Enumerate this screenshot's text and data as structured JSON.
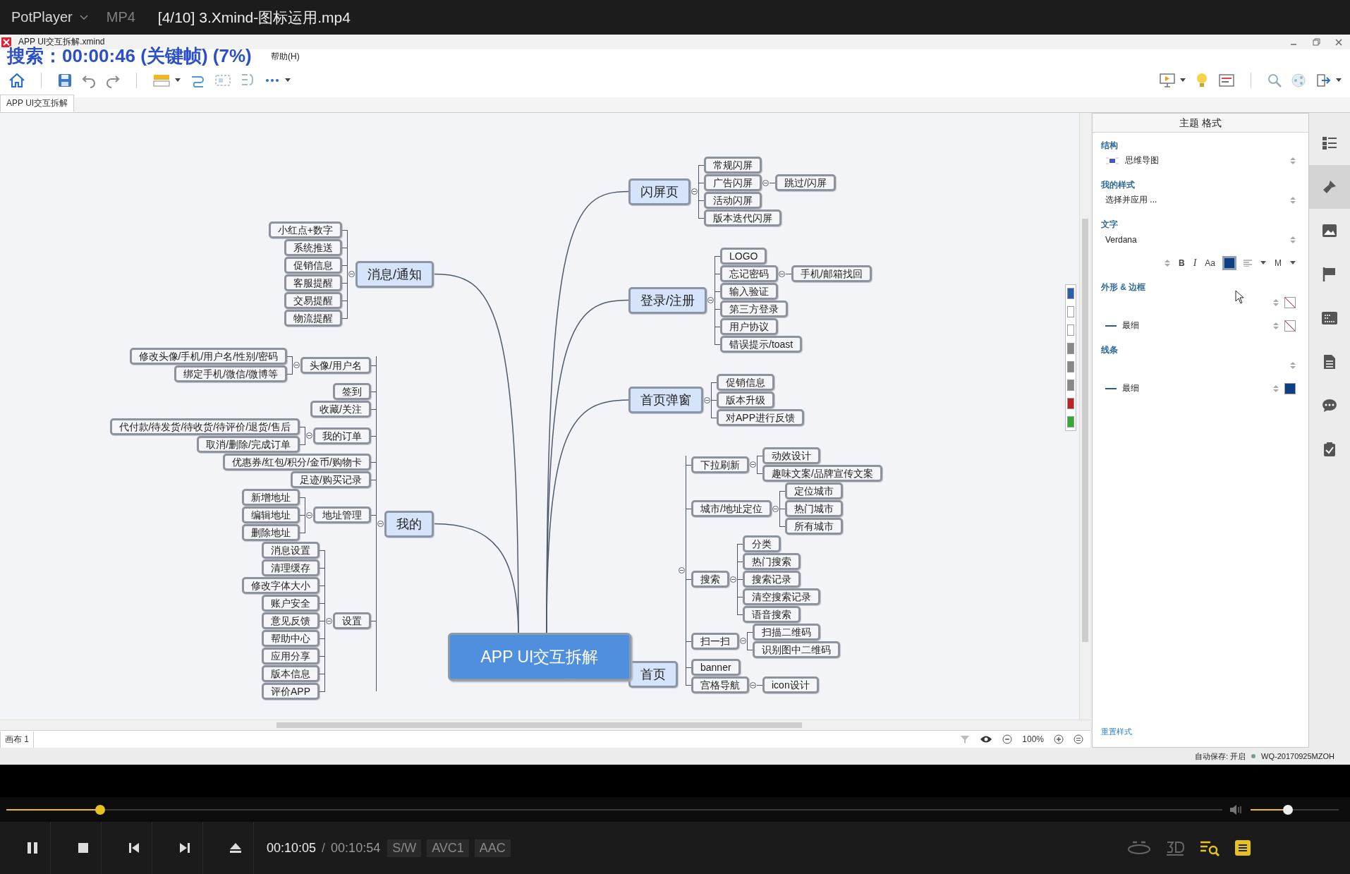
{
  "player": {
    "app_name": "PotPlayer",
    "format": "MP4",
    "title": "[4/10] 3.Xmind-图标运用.mp4"
  },
  "osd": "搜索：00:00:46 (关键帧) (7%)",
  "xmind": {
    "window_title": "APP UI交互拆解.xmind",
    "menu": [
      "帮助(H)"
    ],
    "tabs": [
      {
        "label": "APP UI交互拆解",
        "selected": true
      }
    ],
    "map": {
      "root": "APP UI交互拆解",
      "right": [
        {
          "text": "闪屏页",
          "children": [
            {
              "text": "常规闪屏"
            },
            {
              "text": "广告闪屏",
              "children": [
                {
                  "text": "跳过/闪屏"
                }
              ]
            },
            {
              "text": "活动闪屏"
            },
            {
              "text": "版本迭代闪屏"
            }
          ]
        },
        {
          "text": "登录/注册",
          "children": [
            {
              "text": "LOGO"
            },
            {
              "text": "忘记密码",
              "children": [
                {
                  "text": "手机/邮箱找回"
                }
              ]
            },
            {
              "text": "输入验证"
            },
            {
              "text": "第三方登录"
            },
            {
              "text": "用户协议"
            },
            {
              "text": "错误提示/toast"
            }
          ]
        },
        {
          "text": "首页弹窗",
          "children": [
            {
              "text": "促销信息"
            },
            {
              "text": "版本升级"
            },
            {
              "text": "对APP进行反馈"
            }
          ]
        },
        {
          "text": "首页",
          "children": [
            {
              "text": "下拉刷新",
              "children": [
                {
                  "text": "动效设计"
                },
                {
                  "text": "趣味文案/品牌宣传文案"
                }
              ]
            },
            {
              "text": "城市/地址定位",
              "children": [
                {
                  "text": "定位城市"
                },
                {
                  "text": "热门城市"
                },
                {
                  "text": "所有城市"
                }
              ]
            },
            {
              "text": "搜索",
              "children": [
                {
                  "text": "分类"
                },
                {
                  "text": "热门搜索"
                },
                {
                  "text": "搜索记录"
                },
                {
                  "text": "清空搜索记录"
                },
                {
                  "text": "语音搜索"
                }
              ]
            },
            {
              "text": "扫一扫",
              "children": [
                {
                  "text": "扫描二维码"
                },
                {
                  "text": "识别图中二维码"
                }
              ]
            },
            {
              "text": "banner"
            },
            {
              "text": "宫格导航",
              "children": [
                {
                  "text": "icon设计"
                }
              ]
            }
          ]
        }
      ],
      "left": [
        {
          "text": "消息/通知",
          "children": [
            {
              "text": "小红点+数字"
            },
            {
              "text": "系统推送"
            },
            {
              "text": "促销信息"
            },
            {
              "text": "客服提醒"
            },
            {
              "text": "交易提醒"
            },
            {
              "text": "物流提醒"
            }
          ]
        },
        {
          "text": "我的",
          "children": [
            {
              "text": "头像/用户名",
              "children": [
                {
                  "text": "修改头像/手机/用户名/性别/密码"
                },
                {
                  "text": "绑定手机/微信/微博等"
                }
              ]
            },
            {
              "text": "签到"
            },
            {
              "text": "收藏/关注"
            },
            {
              "text": "我的订单",
              "children": [
                {
                  "text": "代付款/待发货/待收货/待评价/退货/售后"
                },
                {
                  "text": "取消/删除/完成订单"
                }
              ]
            },
            {
              "text": "优惠券/红包/积分/金币/购物卡"
            },
            {
              "text": "足迹/购买记录"
            },
            {
              "text": "地址管理",
              "children": [
                {
                  "text": "新增地址"
                },
                {
                  "text": "编辑地址"
                },
                {
                  "text": "删除地址"
                }
              ]
            },
            {
              "text": "设置",
              "children": [
                {
                  "text": "消息设置"
                },
                {
                  "text": "清理缓存"
                },
                {
                  "text": "修改字体大小"
                },
                {
                  "text": "账户安全"
                },
                {
                  "text": "意见反馈"
                },
                {
                  "text": "帮助中心"
                },
                {
                  "text": "应用分享"
                },
                {
                  "text": "版本信息"
                },
                {
                  "text": "评价APP"
                }
              ]
            }
          ]
        }
      ]
    },
    "sheet_tabs": [
      {
        "label": "画布 1",
        "selected": true
      }
    ],
    "zoom": "100%",
    "format_panel": {
      "title": "主题 格式",
      "structure": {
        "label": "结构",
        "value": "思维导图"
      },
      "my_style": {
        "label": "我的样式",
        "value": "选择并应用 ..."
      },
      "text": {
        "label": "文字",
        "font": "Verdana",
        "buttons": [
          "B",
          "I",
          "Aa"
        ],
        "color": "#0d3f85",
        "size": "M"
      },
      "shape": {
        "label": "外形 & 边框",
        "no_fill": true,
        "border_width": "最细",
        "no_border_color": true
      },
      "line": {
        "label": "线条",
        "width": "最细",
        "color": "#0d3f85"
      },
      "reset": "重置样式"
    },
    "side_icons": [
      {
        "kind": "outline",
        "selected": false
      },
      {
        "kind": "format",
        "selected": true
      },
      {
        "kind": "image",
        "selected": false
      },
      {
        "kind": "marker",
        "selected": false
      },
      {
        "kind": "text",
        "selected": false
      },
      {
        "kind": "notes",
        "selected": false
      },
      {
        "kind": "comment",
        "selected": false
      },
      {
        "kind": "task",
        "selected": false
      }
    ],
    "status": {
      "autosave": "自动保存: 开启",
      "user": "WQ-20170925MZOH"
    }
  },
  "playback": {
    "seek": {
      "level": 0.077
    },
    "volume": {
      "level": 0.42
    },
    "current_time": "00:10:05",
    "separator": "/",
    "total_time": "00:10:54",
    "tags": [
      "S/W",
      "AVC1",
      "AAC"
    ]
  }
}
